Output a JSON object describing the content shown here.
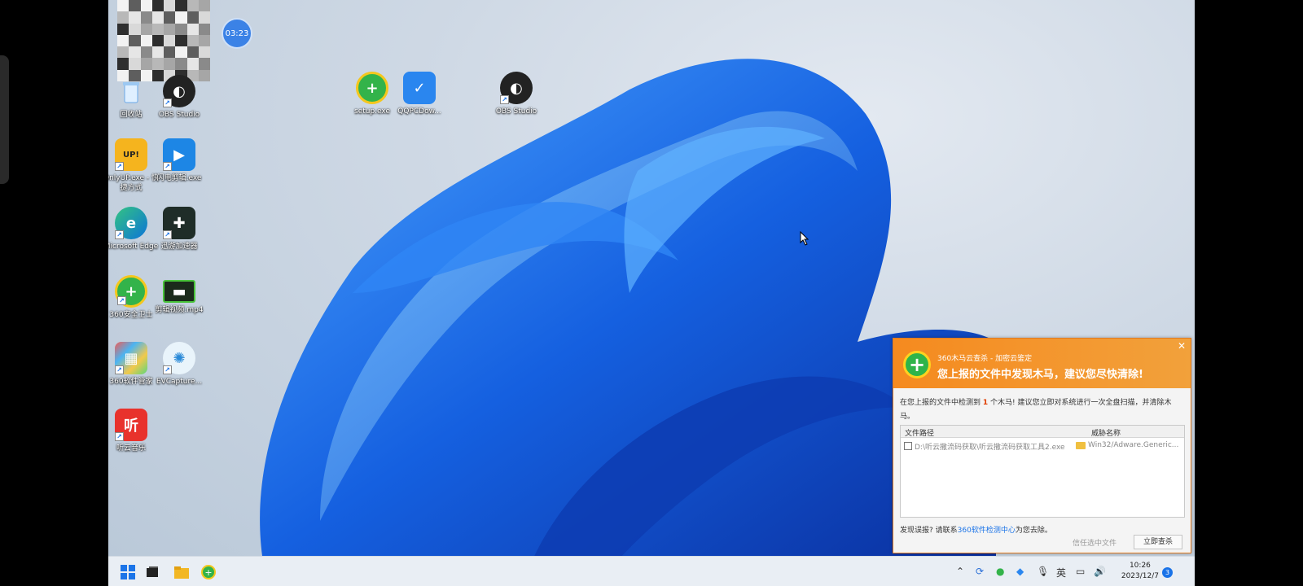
{
  "screen_timer": "03:23",
  "desktop_icons": [
    {
      "label": "回收站"
    },
    {
      "label": "OBS Studio"
    },
    {
      "label": "setup.exe"
    },
    {
      "label": "QQPCDow..."
    },
    {
      "label": "OBS Studio"
    },
    {
      "label": "OnlyUP.exe - 快捷方式"
    },
    {
      "label": "闪电剪辑.exe"
    },
    {
      "label": "Microsoft Edge"
    },
    {
      "label": "迅游加速器"
    },
    {
      "label": "360安全卫士"
    },
    {
      "label": "剪辑视频.mp4"
    },
    {
      "label": "360软件管家"
    },
    {
      "label": "EVCapture..."
    },
    {
      "label": "听云音乐"
    }
  ],
  "taskbar": {
    "clock_time": "10:26",
    "clock_date": "2023/12/7",
    "ime": "英",
    "notification_count": "3"
  },
  "popup": {
    "title_small": "360木马云查杀 - 加密云鉴定",
    "title_big": "您上报的文件中发现木马，建议您尽快清除!",
    "desc_pre": "在您上报的文件中检测到",
    "desc_count": "1",
    "desc_post": "个木马! 建议您立即对系统进行一次全盘扫描，并清除木马。",
    "col_path": "文件路径",
    "col_threat": "威胁名称",
    "rows": [
      {
        "path": "D:\\听云撒流码获取\\听云撒流码获取工具2.exe",
        "threat": "Win32/Adware.Generic..."
      }
    ],
    "foot_pre": "发现误报? 请联系",
    "foot_link": "360软件检测中心",
    "foot_post": "为您去除。",
    "btn_trust": "信任选中文件",
    "btn_now": "立即查杀",
    "accent": "#f58a1f"
  }
}
